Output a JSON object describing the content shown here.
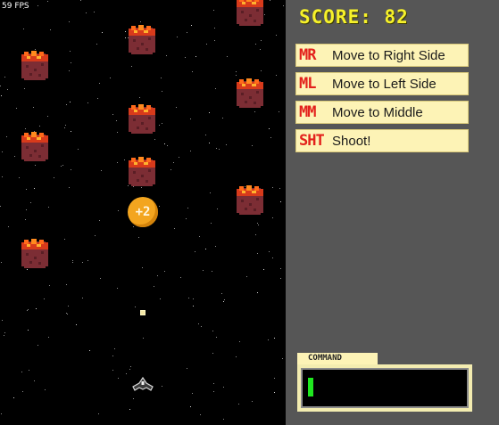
{
  "fps_label": "59 FPS",
  "score": {
    "label": "SCORE: 82"
  },
  "commands": [
    {
      "code": "MR",
      "label": "Move to Right Side"
    },
    {
      "code": "ML",
      "label": "Move to Left Side"
    },
    {
      "code": "MM",
      "label": "Move to Middle"
    },
    {
      "code": "SHT",
      "label": "Shoot!"
    }
  ],
  "command_input": {
    "tab_label": "COMMAND",
    "value": ""
  },
  "bonus": {
    "label": "+2"
  },
  "colors": {
    "space": "#000000",
    "panel": "#565656",
    "score": "#f6f12a",
    "card": "#fdf3b6",
    "code": "#e3211c",
    "cursor": "#1fe81f",
    "bonus": "#f3a51f"
  },
  "icons": {
    "asteroid": "asteroid-icon",
    "ship": "spaceship-icon",
    "bullet": "bullet-icon"
  }
}
